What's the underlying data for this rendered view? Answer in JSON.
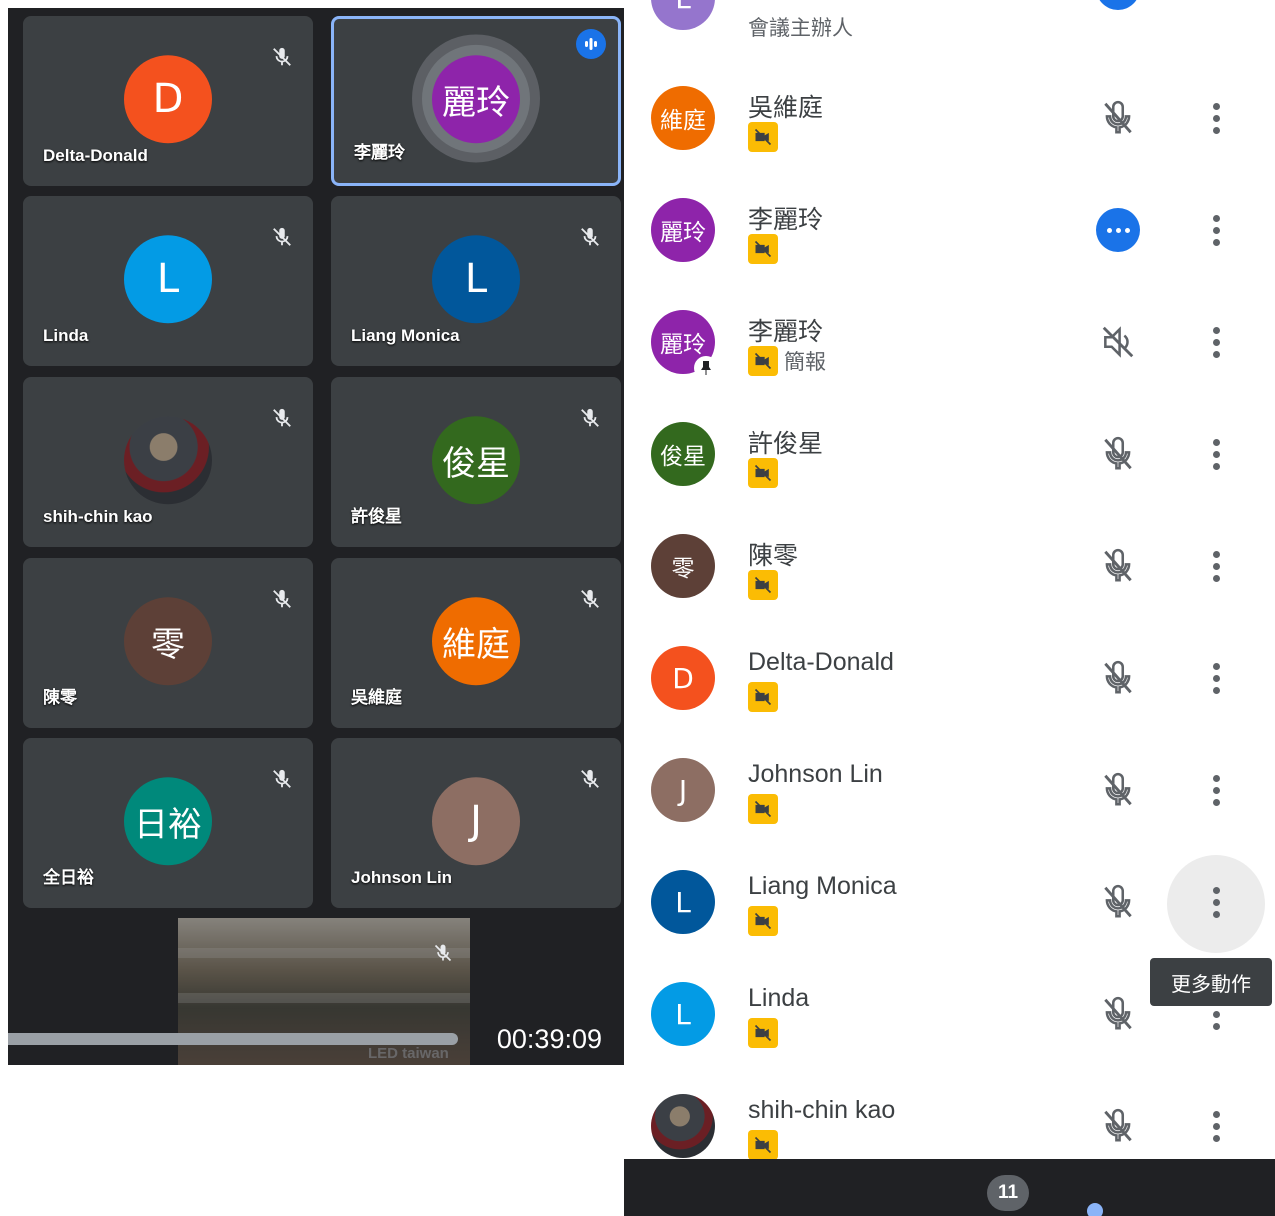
{
  "grid": {
    "tiles": [
      {
        "name": "Delta-Donald",
        "initial": "D",
        "color": "#f4511e"
      },
      {
        "name": "李麗玲",
        "initial": "麗玲",
        "color": "#8e24aa"
      },
      {
        "name": "Linda",
        "initial": "L",
        "color": "#039be5"
      },
      {
        "name": "Liang Monica",
        "initial": "L",
        "color": "#01579b"
      },
      {
        "name": "shih-chin kao",
        "initial": "",
        "color": "#3b3f45"
      },
      {
        "name": "許俊星",
        "initial": "俊星",
        "color": "#33691e"
      },
      {
        "name": "陳零",
        "initial": "零",
        "color": "#5d4037"
      },
      {
        "name": "吳維庭",
        "initial": "維庭",
        "color": "#ef6c00"
      },
      {
        "name": "全日裕",
        "initial": "日裕",
        "color": "#00897b"
      },
      {
        "name": "Johnson Lin",
        "initial": "J",
        "color": "#8d6e63"
      }
    ],
    "self_label": "LED taiwan",
    "timer": "00:39:09"
  },
  "list": {
    "top_partial": {
      "role": "會議主辦人",
      "initial": "L",
      "color": "#9575cd"
    },
    "participants": [
      {
        "name": "吳維庭",
        "initial": "維庭",
        "color": "#ef6c00",
        "status": "",
        "control": "mic-off"
      },
      {
        "name": "李麗玲",
        "initial": "麗玲",
        "color": "#8e24aa",
        "status": "",
        "control": "speaking"
      },
      {
        "name": "李麗玲",
        "initial": "麗玲",
        "color": "#8e24aa",
        "status": "簡報",
        "control": "audio-off"
      },
      {
        "name": "許俊星",
        "initial": "俊星",
        "color": "#33691e",
        "status": "",
        "control": "mic-off"
      },
      {
        "name": "陳零",
        "initial": "零",
        "color": "#5d4037",
        "status": "",
        "control": "mic-off"
      },
      {
        "name": "Delta-Donald",
        "initial": "D",
        "color": "#f4511e",
        "status": "",
        "control": "mic-off"
      },
      {
        "name": "Johnson Lin",
        "initial": "J",
        "color": "#8d6e63",
        "status": "",
        "control": "mic-off"
      },
      {
        "name": "Liang Monica",
        "initial": "L",
        "color": "#01579b",
        "status": "",
        "control": "mic-off"
      },
      {
        "name": "Linda",
        "initial": "L",
        "color": "#039be5",
        "status": "",
        "control": "mic-off"
      },
      {
        "name": "shih-chin kao",
        "initial": "",
        "color": "#3b3f45",
        "status": "",
        "control": "mic-off"
      }
    ],
    "tooltip": "更多動作",
    "participant_count": "11"
  },
  "colors": {
    "accent": "#1a73e8",
    "badge_yellow": "#fbbc04",
    "dark_bg": "#202124",
    "tile_bg": "#3c4043"
  }
}
